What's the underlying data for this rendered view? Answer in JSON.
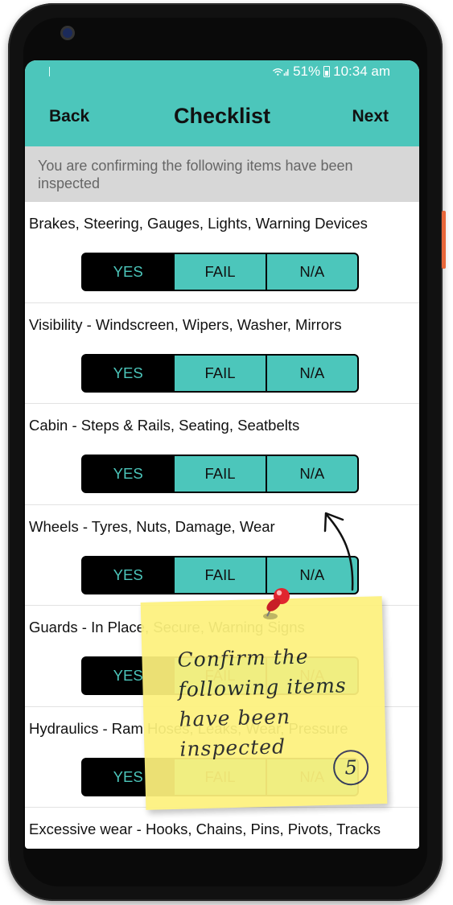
{
  "status_bar": {
    "battery_text": "51%",
    "time": "10:34 am"
  },
  "header": {
    "back_label": "Back",
    "title": "Checklist",
    "next_label": "Next"
  },
  "subheader": "You are confirming the following items have been inspected",
  "options": {
    "yes": "YES",
    "fail": "FAIL",
    "na": "N/A"
  },
  "items": [
    {
      "label": "Brakes, Steering, Gauges, Lights, Warning Devices",
      "selected": "YES"
    },
    {
      "label": "Visibility - Windscreen, Wipers, Washer, Mirrors",
      "selected": "YES"
    },
    {
      "label": "Cabin - Steps & Rails, Seating, Seatbelts",
      "selected": "YES"
    },
    {
      "label": "Wheels - Tyres, Nuts, Damage, Wear",
      "selected": "YES"
    },
    {
      "label": "Guards - In Place, Secure, Warning Signs",
      "selected": "YES"
    },
    {
      "label": "Hydraulics - Ram Hoses, Leaks, Wear, Pressure",
      "selected": "YES"
    },
    {
      "label": "Excessive wear - Hooks, Chains, Pins, Pivots, Tracks",
      "selected": "YES"
    }
  ],
  "annotation": {
    "text": "Confirm the following items have been inspected",
    "step_number": "5"
  },
  "colors": {
    "accent": "#4cc6bb",
    "selected": "#000000",
    "note": "#fdf27d",
    "pin": "#e0262f"
  }
}
